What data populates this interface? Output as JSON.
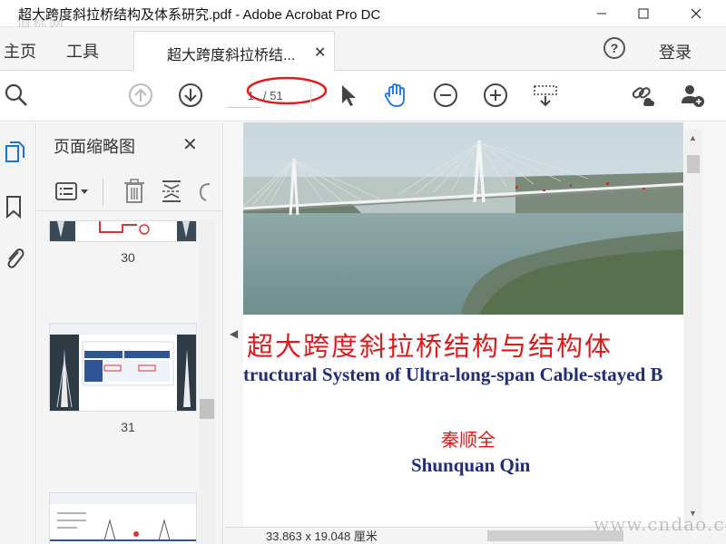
{
  "window": {
    "title": "超大跨度斜拉桥结构及体系研究.pdf - Adobe Acrobat Pro DC",
    "watermark_top": "道标网"
  },
  "tabs": {
    "home": "主页",
    "tools": "工具",
    "document": "超大跨度斜拉桥结...",
    "help": "?",
    "login": "登录"
  },
  "toolbar": {
    "current_page": "1",
    "total_pages": "/ 51"
  },
  "thumbnails": {
    "title": "页面缩略图",
    "items": [
      {
        "page": "30"
      },
      {
        "page": "31"
      }
    ]
  },
  "page": {
    "title_cn": "超大跨度斜拉桥结构与结构体",
    "title_en": "tructural System of Ultra-long-span Cable-stayed B",
    "author_cn": "秦顺全",
    "author_en": "Shunquan Qin"
  },
  "status": {
    "dimensions": "33.863 x 19.048 厘米"
  },
  "watermark": "www.cndao.com",
  "colors": {
    "red_title": "#e01a1a",
    "blue_title": "#1f2d7a",
    "accent_blue": "#1473e6",
    "annotation_red": "#e41b1b"
  },
  "icons": [
    "search-icon",
    "page-up-icon",
    "page-down-icon",
    "select-arrow-icon",
    "hand-icon",
    "zoom-out-icon",
    "zoom-in-icon",
    "marquee-icon",
    "link-share-icon",
    "add-user-icon",
    "pages-icon",
    "bookmark-icon",
    "attachment-icon",
    "options-icon",
    "trash-icon",
    "extract-icon",
    "rotate-icon"
  ]
}
